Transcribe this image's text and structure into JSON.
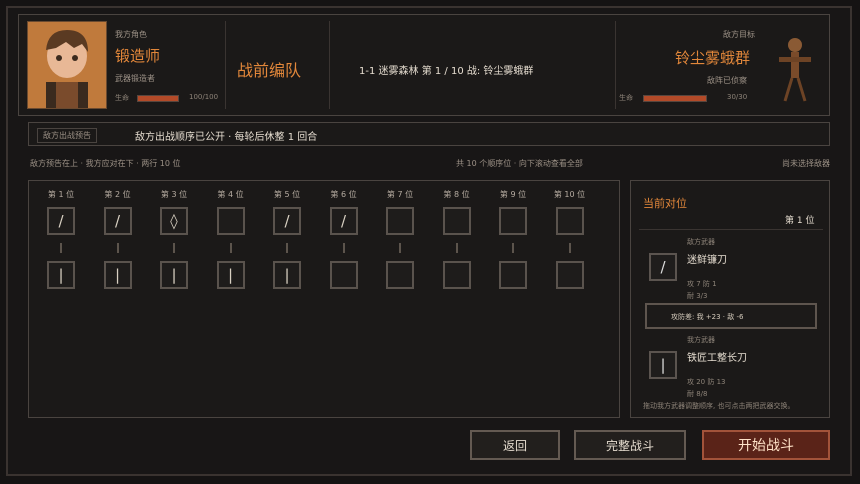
{
  "player": {
    "role_label": "我方角色",
    "name": "锻造师",
    "subtitle": "武器锻造者",
    "hp_label": "生命",
    "hp_text": "100/100",
    "hp_fraction": 1.0
  },
  "title": "战前编队",
  "stage_info": "1-1 迷雾森林 第 1 / 10 战: 铃尘雾蛾群",
  "enemy": {
    "role_label": "敌方目标",
    "name": "铃尘雾蛾群",
    "subtitle": "敌阵已侦察",
    "hp_label": "生命",
    "hp_text": "30/30",
    "hp_fraction": 1.0
  },
  "notice": {
    "tag": "敌方出战预告",
    "text": "敌方出战顺序已公开 · 每轮后休整 1 回合"
  },
  "info_bar": {
    "left": "敌方预告在上 · 我方应对在下 · 两行 10 位",
    "center": "共 10 个顺序位 · 向下滚动查看全部",
    "right": "尚未选择敌器"
  },
  "slots": [
    {
      "label": "第 1 位",
      "enemy_icon": "/",
      "player_icon": "|"
    },
    {
      "label": "第 2 位",
      "enemy_icon": "/",
      "player_icon": "|"
    },
    {
      "label": "第 3 位",
      "enemy_icon": "◊",
      "player_icon": "|"
    },
    {
      "label": "第 4 位",
      "enemy_icon": "",
      "player_icon": "|"
    },
    {
      "label": "第 5 位",
      "enemy_icon": "/",
      "player_icon": "|"
    },
    {
      "label": "第 6 位",
      "enemy_icon": "/",
      "player_icon": ""
    },
    {
      "label": "第 7 位",
      "enemy_icon": "",
      "player_icon": ""
    },
    {
      "label": "第 8 位",
      "enemy_icon": "",
      "player_icon": ""
    },
    {
      "label": "第 9 位",
      "enemy_icon": "",
      "player_icon": ""
    },
    {
      "label": "第 10 位",
      "enemy_icon": "",
      "player_icon": ""
    }
  ],
  "detail": {
    "title": "当前对位",
    "position": "第 1 位",
    "enemy_weapon_tag": "敌方武器",
    "enemy_weapon_name": "迷鲜镰刀",
    "enemy_weapon_stats": "攻 7  防 1",
    "enemy_weapon_sub": "耐 3/3",
    "compare": "攻防差: 我 +23 · 敌 -6",
    "player_weapon_tag": "我方武器",
    "player_weapon_name": "铁匠工整长刀",
    "player_weapon_stats": "攻 20  防 13",
    "player_weapon_sub": "耐 8/8",
    "hint": "拖动我方武器调整顺序, 也可点击两把武器交换。"
  },
  "buttons": {
    "back": "返回",
    "auto": "完整战斗",
    "start": "开始战斗"
  }
}
